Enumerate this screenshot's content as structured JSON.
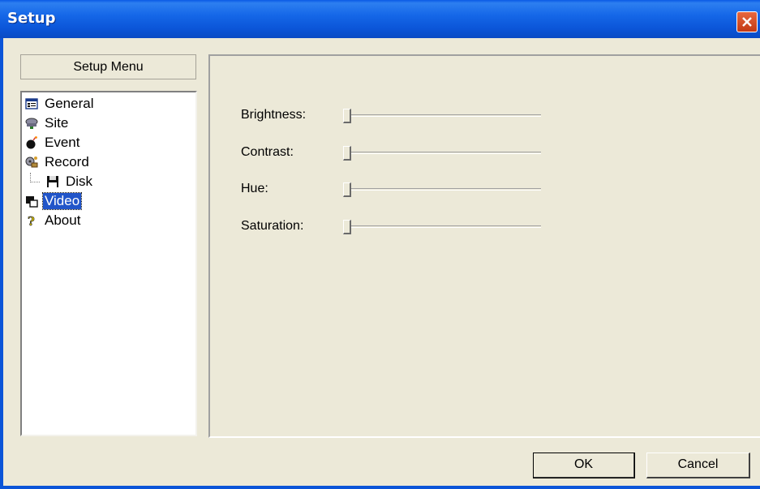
{
  "window": {
    "title": "Setup"
  },
  "menu": {
    "header": "Setup Menu",
    "items": [
      {
        "label": "General",
        "icon": "general-icon"
      },
      {
        "label": "Site",
        "icon": "site-icon"
      },
      {
        "label": "Event",
        "icon": "event-bomb-icon"
      },
      {
        "label": "Record",
        "icon": "record-film-icon"
      },
      {
        "label": "Disk",
        "icon": "disk-floppy-icon"
      },
      {
        "label": "Video",
        "icon": "video-icon",
        "selected": true
      },
      {
        "label": "About",
        "icon": "about-question-icon"
      }
    ]
  },
  "video": {
    "sliders": [
      {
        "label": "Brightness:",
        "value": 0
      },
      {
        "label": "Contrast:",
        "value": 0
      },
      {
        "label": "Hue:",
        "value": 0
      },
      {
        "label": "Saturation:",
        "value": 0
      }
    ]
  },
  "buttons": {
    "ok": "OK",
    "cancel": "Cancel"
  },
  "colors": {
    "title_bar": "#0b55d8",
    "dialog_bg": "#ece9d8",
    "selection": "#2155c9",
    "close": "#d2512b"
  }
}
